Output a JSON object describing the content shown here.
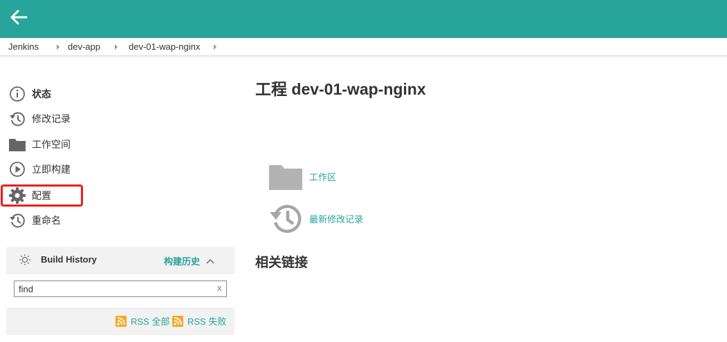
{
  "header": {
    "back_icon": "arrow-left-icon",
    "bg_color": "#27a59a"
  },
  "breadcrumb": [
    "Jenkins",
    "dev-app",
    "dev-01-wap-nginx"
  ],
  "side_tasks": [
    {
      "label": "状态",
      "icon": "info-icon",
      "active": true
    },
    {
      "label": "修改记录",
      "icon": "history-icon"
    },
    {
      "label": "工作空间",
      "icon": "folder-icon"
    },
    {
      "label": "立即构建",
      "icon": "play-icon"
    },
    {
      "label": "配置",
      "icon": "gear-icon",
      "highlighted": true,
      "highlight_color": "#ee1c1c"
    },
    {
      "label": "重命名",
      "icon": "history-icon"
    }
  ],
  "build_history": {
    "title": "Build History",
    "link": "构建历史",
    "search_value": "find",
    "clear": "x",
    "rss_all": "RSS 全部",
    "rss_failed": "RSS 失败"
  },
  "main": {
    "title": "工程 dev-01-wap-nginx",
    "links": [
      {
        "label": "工作区",
        "icon": "folder-icon"
      },
      {
        "label": "最新修改记录",
        "icon": "history-icon"
      }
    ],
    "related_heading": "相关链接"
  },
  "colors": {
    "accent": "#27a59a",
    "highlight": "#ee1c1c"
  }
}
